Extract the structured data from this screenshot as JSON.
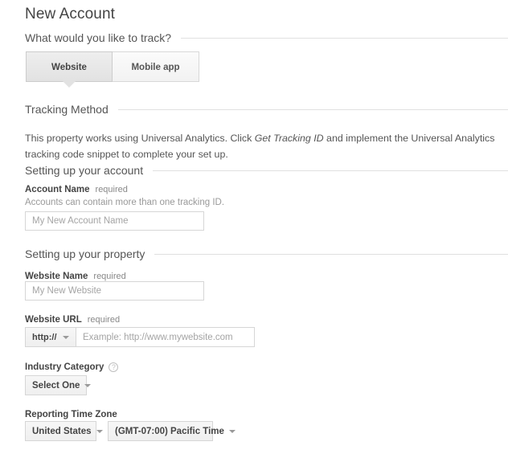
{
  "page": {
    "title": "New Account"
  },
  "track_section": {
    "heading": "What would you like to track?",
    "tabs": [
      {
        "label": "Website",
        "selected": true
      },
      {
        "label": "Mobile app",
        "selected": false
      }
    ]
  },
  "tracking_method": {
    "heading": "Tracking Method",
    "paragraph_part1": "This property works using Universal Analytics. Click ",
    "paragraph_emphasis": "Get Tracking ID",
    "paragraph_part2": " and implement the Universal Analytics tracking code snippet to complete your set up."
  },
  "account_section": {
    "heading": "Setting up your account",
    "account_name": {
      "label": "Account Name",
      "required": "required",
      "hint": "Accounts can contain more than one tracking ID.",
      "value": "",
      "placeholder": "My New Account Name"
    }
  },
  "property_section": {
    "heading": "Setting up your property",
    "website_name": {
      "label": "Website Name",
      "required": "required",
      "value": "",
      "placeholder": "My New Website"
    },
    "website_url": {
      "label": "Website URL",
      "required": "required",
      "scheme": "http://",
      "value": "",
      "placeholder": "Example: http://www.mywebsite.com"
    },
    "industry_category": {
      "label": "Industry Category",
      "help_icon": "question-mark-icon",
      "selected": "Select One"
    },
    "reporting_time_zone": {
      "label": "Reporting Time Zone",
      "country_selected": "United States",
      "zone_selected": "(GMT-07:00) Pacific Time"
    }
  },
  "icons": {
    "caret_down": "chevron-down-icon"
  },
  "colors": {
    "text_primary": "#444444",
    "text_secondary": "#555555",
    "text_muted": "#999999",
    "border": "#d6d6d6",
    "rule": "#e0e0e0",
    "tab_selected_bg": "#e2e2e2",
    "tab_bg": "#f2f2f2"
  }
}
